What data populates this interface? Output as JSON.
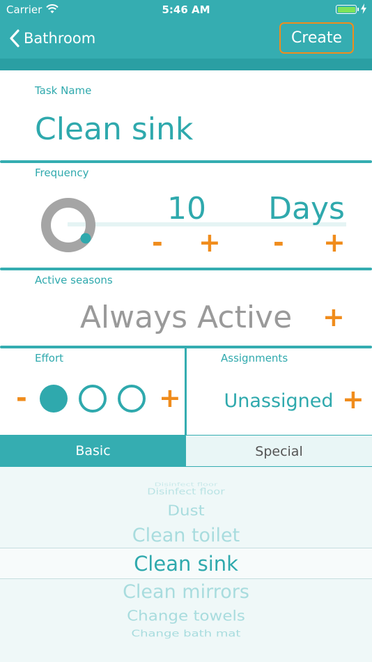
{
  "status": {
    "carrier": "Carrier",
    "time": "5:46 AM"
  },
  "nav": {
    "back_label": "Bathroom",
    "create_label": "Create"
  },
  "task_name": {
    "label": "Task Name",
    "value": "Clean sink"
  },
  "frequency": {
    "label": "Frequency",
    "number": "10",
    "unit": "Days",
    "minus": "-",
    "plus": "+"
  },
  "seasons": {
    "label": "Active seasons",
    "value": "Always Active",
    "plus": "+"
  },
  "effort": {
    "label": "Effort",
    "minus": "-",
    "plus": "+",
    "level": 1,
    "max": 3
  },
  "assignments": {
    "label": "Assignments",
    "value": "Unassigned",
    "plus": "+"
  },
  "tabs": {
    "basic": "Basic",
    "special": "Special",
    "selected": "Basic"
  },
  "picker": {
    "items": [
      "Disinfect floor",
      "Dust",
      "Clean toilet",
      "Clean sink",
      "Clean mirrors",
      "Change towels",
      "Change bath mat"
    ],
    "selected": "Clean sink"
  },
  "colors": {
    "accent": "#35adb1",
    "orange": "#f08c1c",
    "inactive_text": "#9a9a9a"
  }
}
